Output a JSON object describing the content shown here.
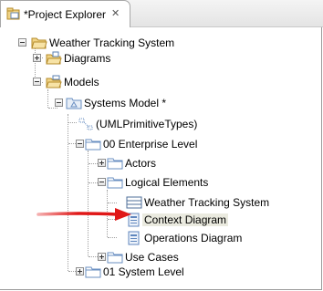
{
  "window": {
    "tab_title": "*Project Explorer",
    "tab_close": "✕"
  },
  "tree": {
    "root": "Weather Tracking System",
    "diagrams": "Diagrams",
    "models": "Models",
    "systems_model": "Systems Model *",
    "uml_primitive_types": "(UMLPrimitiveTypes)",
    "enterprise_level": "00 Enterprise Level",
    "actors": "Actors",
    "logical_elements": "Logical Elements",
    "weather_tracking_system": "Weather Tracking System",
    "context_diagram": "Context Diagram",
    "operations_diagram": "Operations Diagram",
    "use_cases": "Use Cases",
    "system_level": "01 System Level"
  },
  "colors": {
    "arrow": "#e01818",
    "folder": "#e9c25a",
    "package_folder": "#6a8fc2",
    "selection": "#eaeadf"
  },
  "icons": {
    "explorer": "project-explorer-icon",
    "project": "project-folder-icon",
    "folder": "folder-icon",
    "package": "package-icon",
    "diagram": "diagram-icon",
    "block": "block-icon"
  }
}
